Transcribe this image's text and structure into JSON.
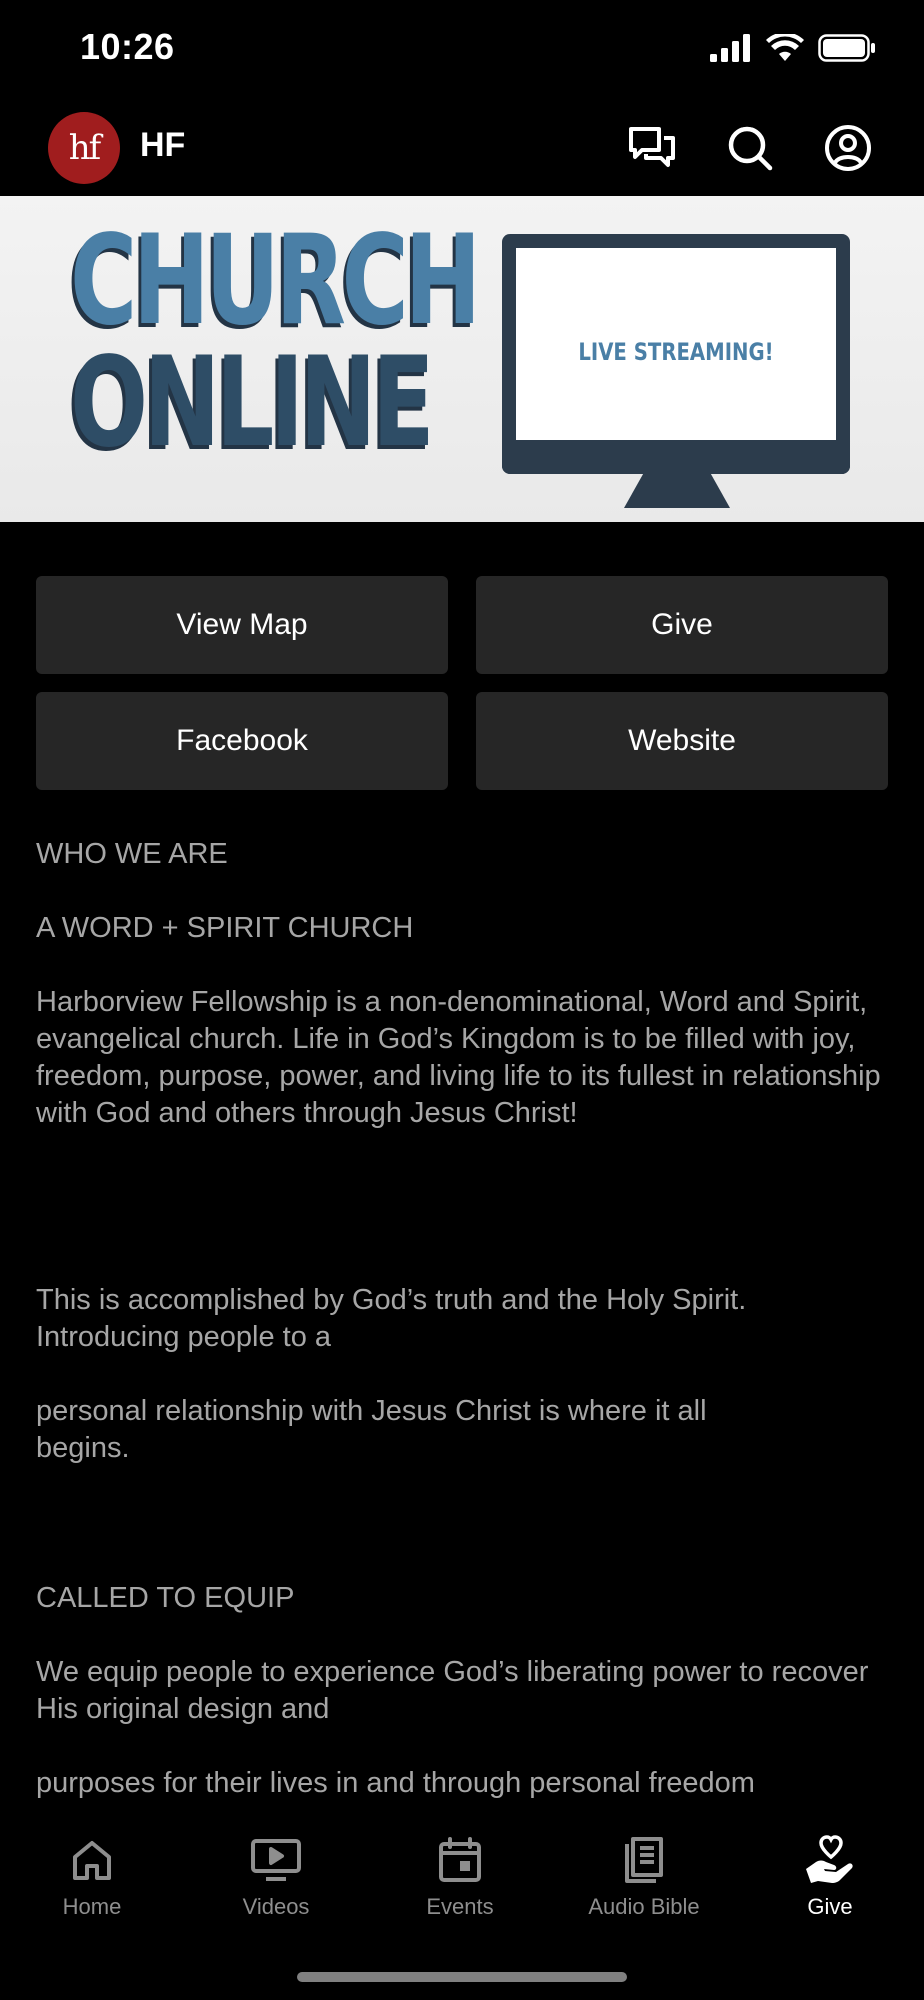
{
  "status_bar": {
    "time": "10:26"
  },
  "header": {
    "logo_text": "hf",
    "title": "HF"
  },
  "banner": {
    "line1": "CHURCH",
    "line2": "ONLINE",
    "monitor_text": "LIVE STREAMING!"
  },
  "actions": {
    "view_map": "View Map",
    "give": "Give",
    "facebook": "Facebook",
    "website": "Website"
  },
  "content": {
    "p1": "WHO WE ARE",
    "p2": "A WORD + SPIRIT CHURCH",
    "p3": "Harborview Fellowship is a non-denominational, Word and Spirit, evangelical church. Life in God’s Kingdom is to be filled with joy, freedom, purpose, power, and living life to its fullest in relationship with God and others through Jesus Christ!",
    "p4": "This is accomplished by God’s truth and the Holy Spirit. Introducing people to a",
    "p5": "personal relationship with Jesus Christ is where it all begins.",
    "p6": "CALLED TO EQUIP",
    "p7": "We equip people to experience God’s liberating power to recover His original design and",
    "p8": "purposes for their lives in and through personal freedom"
  },
  "tabs": [
    {
      "label": "Home",
      "icon": "home-icon"
    },
    {
      "label": "Videos",
      "icon": "video-icon"
    },
    {
      "label": "Events",
      "icon": "calendar-icon"
    },
    {
      "label": "Audio Bible",
      "icon": "book-icon"
    },
    {
      "label": "Give",
      "icon": "give-heart-hand-icon",
      "active": true
    }
  ],
  "colors": {
    "background": "#000000",
    "button_bg": "#262626",
    "logo_red": "#a01d1e",
    "body_text": "#a6a6a6",
    "tab_inactive": "#8e8e8e"
  }
}
